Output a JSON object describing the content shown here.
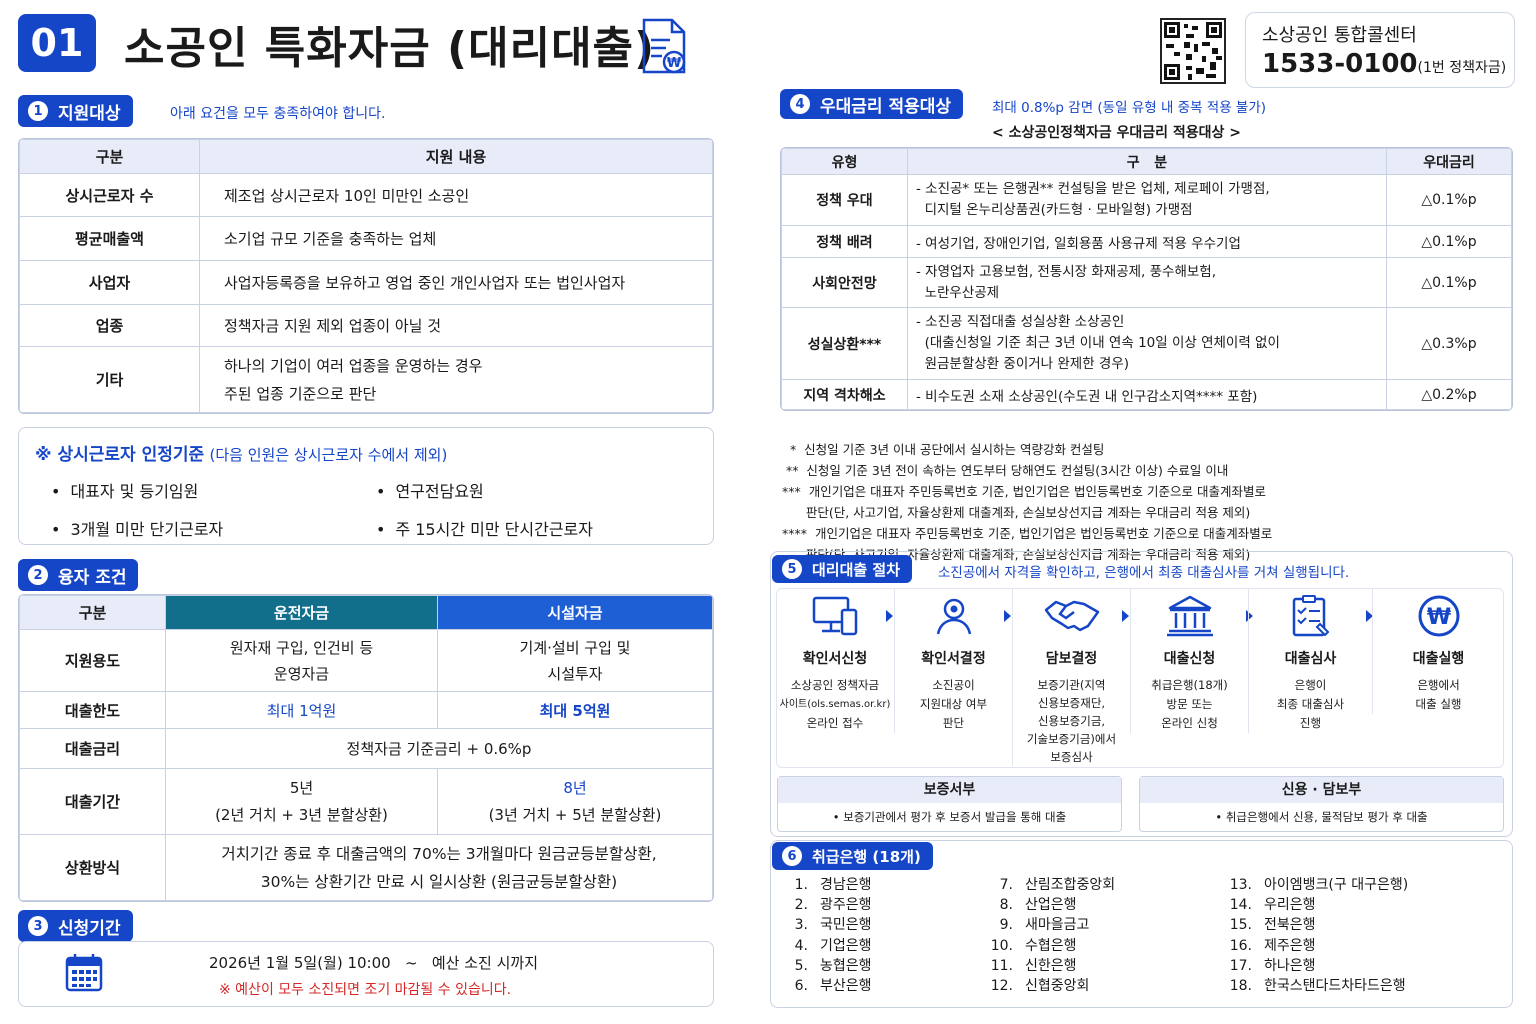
{
  "header": {
    "num": "01",
    "title": "소공인 특화자금 (대리대출)",
    "call_center": "소상공인 통합콜센터",
    "phone": "1533-0100",
    "phone_note": "(1번 정책자금)"
  },
  "s1": {
    "num": "1",
    "label": "지원대상",
    "note": "아래 요건을 모두 충족하여야 합니다.",
    "headers": [
      "구분",
      "지원 내용"
    ],
    "rows": [
      [
        "상시근로자 수",
        "제조업 상시근로자 10인 미만인 소공인"
      ],
      [
        "평균매출액",
        "소기업 규모 기준을 충족하는 업체"
      ],
      [
        "사업자",
        "사업자등록증을 보유하고 영업 중인 개인사업자 또는 법인사업자"
      ],
      [
        "업종",
        "정책자금 지원 제외 업종이 아닐 것"
      ],
      [
        "기타",
        "하나의 기업이 여러 업종을 운영하는 경우",
        "주된 업종 기준으로 판단"
      ]
    ],
    "criteria_title": "※  상시근로자 인정기준",
    "criteria_sub": "(다음 인원은 상시근로자 수에서 제외)",
    "criteria": [
      "대표자 및 등기임원",
      "연구전담요원",
      "3개월 미만 단기근로자",
      "주 15시간 미만 단시간근로자"
    ]
  },
  "s2": {
    "num": "2",
    "label": "융자 조건",
    "headers": [
      "구분",
      "운전자금",
      "시설자금"
    ],
    "use_label": "지원용도",
    "use_op1": "원자재 구입, 인건비 등",
    "use_op2": "운영자금",
    "use_fa1": "기계·설비 구입 및",
    "use_fa2": "시설투자",
    "limit_label": "대출한도",
    "limit_op": "최대 1억원",
    "limit_fa": "최대 5억원",
    "rate_label": "대출금리",
    "rate": "정책자금 기준금리 + 0.6%p",
    "term_label": "대출기간",
    "term_op": "5년",
    "term_op2": "(2년 거치 + 3년 분할상환)",
    "term_fa": "8년",
    "term_fa2": "(3년 거치 + 5년 분할상환)",
    "repay_label": "상환방식",
    "repay1": "거치기간 종료 후 대출금액의 70%는 3개월마다 원금균등분할상환,",
    "repay2": "30%는 상환기간 만료 시 일시상환 (원금균등분할상환)"
  },
  "s3": {
    "num": "3",
    "label": "신청기간",
    "period": "2026년 1월 5일(월) 10:00   ~   예산 소진 시까지",
    "warn": "※ 예산이 모두 소진되면 조기 마감될 수 있습니다."
  },
  "s4": {
    "num": "4",
    "label": "우대금리 적용대상",
    "note": "최대 0.8%p 감면 (동일 유형 내 중복 적용 불가)",
    "subtitle": "< 소상공인정책자금 우대금리 적용대상 >",
    "headers": [
      "유형",
      "구   분",
      "우대금리"
    ],
    "rows": [
      {
        "type": "정책 우대",
        "lines": [
          "- 소진공* 또는 은행권** 컨설팅을 받은 업체, 제로페이 가맹점,",
          "  디지털 온누리상품권(카드형 · 모바일형) 가맹점"
        ],
        "rate": "△0.1%p"
      },
      {
        "type": "정책 배려",
        "lines": [
          "- 여성기업, 장애인기업, 일회용품 사용규제 적용 우수기업"
        ],
        "rate": "△0.1%p"
      },
      {
        "type": "사회안전망",
        "lines": [
          "- 자영업자 고용보험, 전통시장 화재공제, 풍수해보험,",
          "  노란우산공제"
        ],
        "rate": "△0.1%p"
      },
      {
        "type": "성실상환***",
        "lines": [
          "- 소진공 직접대출 성실상환 소상공인",
          "  (대출신청일 기준 최근 3년 이내 연속 10일 이상 연체이력 없이",
          "  원금분할상환 중이거나 완제한 경우)"
        ],
        "rate": "△0.3%p"
      },
      {
        "type": "지역 격차해소",
        "lines": [
          "- 비수도권 소재 소상공인(수도권 내 인구감소지역**** 포함)"
        ],
        "rate": "△0.2%p"
      }
    ],
    "footnotes": [
      "  *  신청일 기준 3년 이내 공단에서 실시하는 역량강화 컨설팅",
      " **  신청일 기준 3년 전이 속하는 연도부터 당해연도 컨설팅(3시간 이상) 수료일 이내",
      "***  개인기업은 대표자 주민등록번호 기준, 법인기업은 법인등록번호 기준으로 대출계좌별로",
      "      판단(단, 사고기업, 자율상환제 대출계좌, 손실보상선지급 계좌는 우대금리 적용 제외)",
      "****  개인기업은 대표자 주민등록번호 기준, 법인기업은 법인등록번호 기준으로 대출계좌별로",
      "      판단(단, 사고기업, 자율상환제 대출계좌, 손실보상선지급 계좌는 우대금리 적용 제외)"
    ]
  },
  "s5": {
    "num": "5",
    "label": "대리대출 절차",
    "note": "소진공에서 자격을 확인하고, 은행에서 최종 대출심사를 거쳐 실행됩니다.",
    "steps": [
      {
        "title": "확인서신청",
        "desc": [
          "소상공인 정책자금",
          "사이트(ols.semas.or.kr)",
          "온라인 접수"
        ]
      },
      {
        "title": "확인서결정",
        "desc": [
          "소진공이",
          "지원대상 여부",
          "판단"
        ]
      },
      {
        "title": "담보결정",
        "desc": [
          "보증기관(지역",
          "신용보증재단,",
          "신용보증기금,",
          "기술보증기금)에서",
          "보증심사"
        ]
      },
      {
        "title": "대출신청",
        "desc": [
          "취급은행(18개)",
          "방문 또는",
          "온라인 신청"
        ]
      },
      {
        "title": "대출심사",
        "desc": [
          "은행이",
          "최종 대출심사",
          "진행"
        ]
      },
      {
        "title": "대출실행",
        "desc": [
          "은행에서",
          "대출 실행"
        ]
      }
    ],
    "left_head": "보증서부",
    "left_desc": "• 보증기관에서 평가 후 보증서 발급을 통해 대출",
    "right_head": "신용 · 담보부",
    "right_desc": "• 취급은행에서 신용, 물적담보 평가 후 대출"
  },
  "s6": {
    "num": "6",
    "label": "취급은행 (18개)",
    "banks": [
      "경남은행",
      "광주은행",
      "국민은행",
      "기업은행",
      "농협은행",
      "부산은행",
      "산림조합중앙회",
      "산업은행",
      "새마을금고",
      "수협은행",
      "신한은행",
      "신협중앙회",
      "아이엠뱅크(구 대구은행)",
      "우리은행",
      "전북은행",
      "제주은행",
      "하나은행",
      "한국스탠다드차타드은행"
    ]
  }
}
